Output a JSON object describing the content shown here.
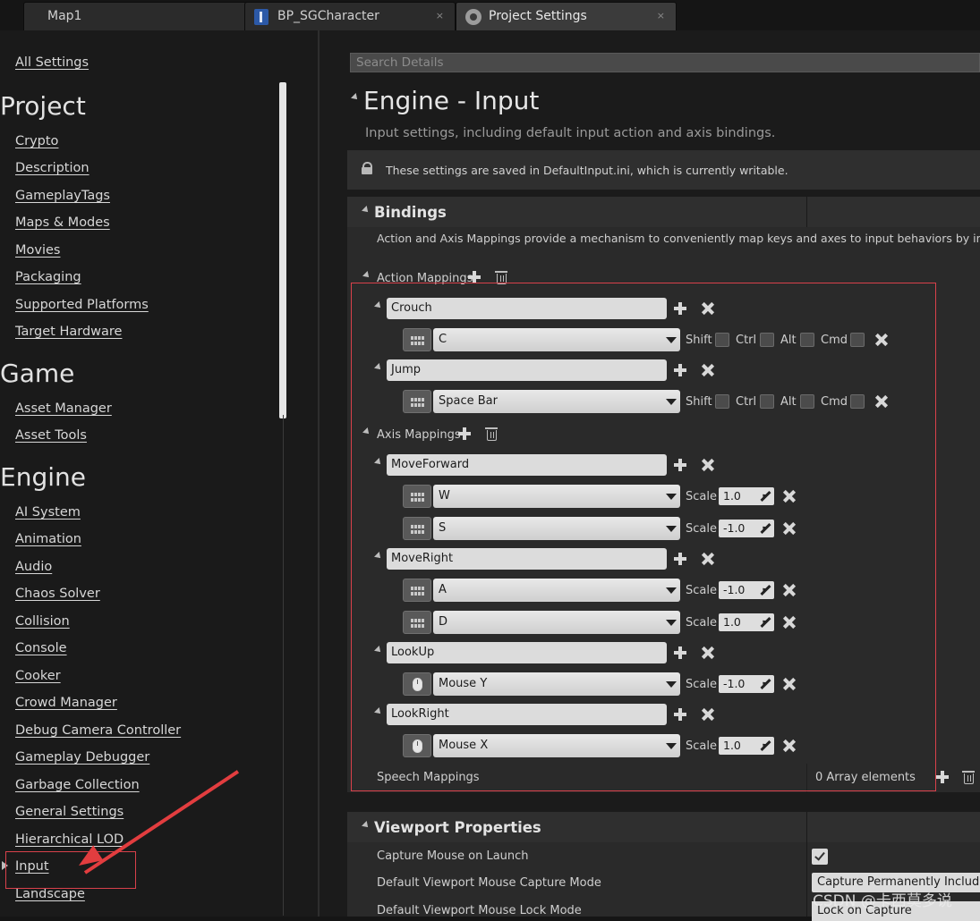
{
  "tabs": [
    {
      "label": "Map1"
    },
    {
      "label": "BP_SGCharacter"
    },
    {
      "label": "Project Settings"
    }
  ],
  "tab_close_glyph": "×",
  "sidebar": {
    "all_settings": "All Settings",
    "headings": {
      "project": "Project",
      "game": "Game",
      "engine": "Engine"
    },
    "project_items": [
      "Crypto",
      "Description",
      "GameplayTags",
      "Maps & Modes",
      "Movies",
      "Packaging",
      "Supported Platforms",
      "Target Hardware"
    ],
    "game_items": [
      "Asset Manager",
      "Asset Tools"
    ],
    "engine_items": [
      "AI System",
      "Animation",
      "Audio",
      "Chaos Solver",
      "Collision",
      "Console",
      "Cooker",
      "Crowd Manager",
      "Debug Camera Controller",
      "Gameplay Debugger",
      "Garbage Collection",
      "General Settings",
      "Hierarchical LOD",
      "Input",
      "Landscape"
    ]
  },
  "search": {
    "placeholder": "Search Details"
  },
  "page": {
    "title": "Engine - Input",
    "subtitle": "Input settings, including default input action and axis bindings.",
    "notice": "These settings are saved in DefaultInput.ini, which is currently writable."
  },
  "bindings": {
    "title": "Bindings",
    "description": "Action and Axis Mappings provide a mechanism to conveniently map keys and axes to input behaviors by inserting a la while Axis Mappings allow for inputs that have a continuous range.",
    "action_label": "Action Mappings",
    "axis_label": "Axis Mappings",
    "modifiers": {
      "shift": "Shift",
      "ctrl": "Ctrl",
      "alt": "Alt",
      "cmd": "Cmd"
    },
    "scale_label": "Scale",
    "actions": [
      {
        "name": "Crouch",
        "key": "C"
      },
      {
        "name": "Jump",
        "key": "Space Bar"
      }
    ],
    "axes": [
      {
        "name": "MoveForward",
        "keys": [
          {
            "key": "W",
            "scale": "1.0",
            "icon": "keyboard-icon"
          },
          {
            "key": "S",
            "scale": "-1.0",
            "icon": "keyboard-icon"
          }
        ]
      },
      {
        "name": "MoveRight",
        "keys": [
          {
            "key": "A",
            "scale": "-1.0",
            "icon": "keyboard-icon"
          },
          {
            "key": "D",
            "scale": "1.0",
            "icon": "keyboard-icon"
          }
        ]
      },
      {
        "name": "LookUp",
        "keys": [
          {
            "key": "Mouse Y",
            "scale": "-1.0",
            "icon": "mouse-icon"
          }
        ]
      },
      {
        "name": "LookRight",
        "keys": [
          {
            "key": "Mouse X",
            "scale": "1.0",
            "icon": "mouse-icon"
          }
        ]
      }
    ],
    "speech_label": "Speech Mappings",
    "speech_count": "0 Array elements"
  },
  "viewport": {
    "title": "Viewport Properties",
    "capture_label": "Capture Mouse on Launch",
    "capture_checked": true,
    "capture_mode_label": "Default Viewport Mouse Capture Mode",
    "capture_mode_value": "Capture Permanently Including I",
    "lock_mode_label": "Default Viewport Mouse Lock Mode",
    "lock_mode_value": "Lock on Capture"
  },
  "watermark": "CSDN @卡西莫多说",
  "colors": {
    "annotation": "#d9414b",
    "arrow": "#e23d3f"
  }
}
